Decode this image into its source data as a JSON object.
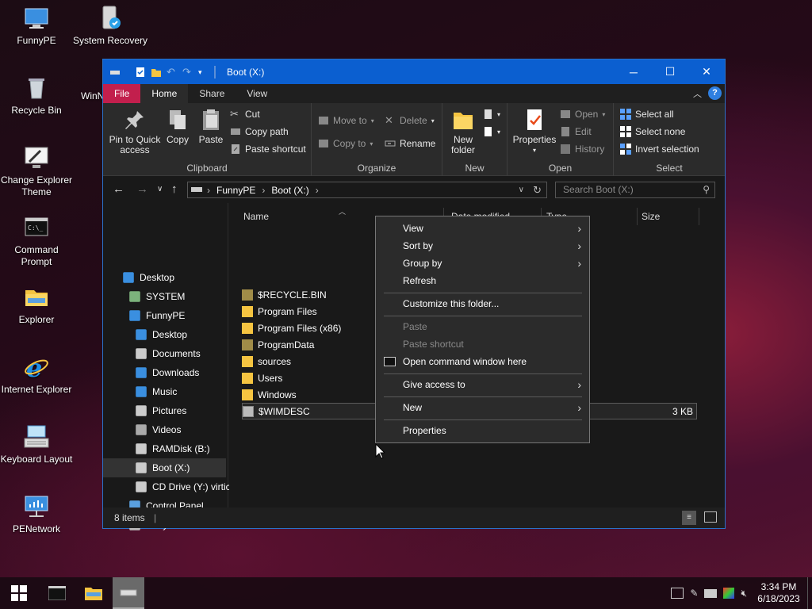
{
  "desktop": {
    "icons": [
      {
        "label": "FunnyPE"
      },
      {
        "label": "System Recovery"
      },
      {
        "label": "Recycle Bin"
      },
      {
        "label": "WinN"
      },
      {
        "label": "Change Explorer Theme"
      },
      {
        "label": "Command Prompt"
      },
      {
        "label": "Explorer"
      },
      {
        "label": "Internet Explorer"
      },
      {
        "label": "Keyboard Layout"
      },
      {
        "label": "PENetwork"
      }
    ]
  },
  "window": {
    "title": "Boot (X:)",
    "tabs": [
      "File",
      "Home",
      "Share",
      "View"
    ],
    "ribbon": {
      "clipboard": {
        "label": "Clipboard",
        "pin": "Pin to Quick access",
        "pin_l1": "Pin to Quick",
        "pin_l2": "access",
        "copy": "Copy",
        "paste": "Paste",
        "cut": "Cut",
        "copy_path": "Copy path",
        "paste_shortcut": "Paste shortcut"
      },
      "organize": {
        "label": "Organize",
        "move_to": "Move to",
        "copy_to": "Copy to",
        "delete": "Delete",
        "rename": "Rename"
      },
      "new": {
        "label": "New",
        "new_folder_l1": "New",
        "new_folder_l2": "folder"
      },
      "open": {
        "label": "Open",
        "properties": "Properties",
        "open": "Open",
        "edit": "Edit",
        "history": "History"
      },
      "select": {
        "label": "Select",
        "select_all": "Select all",
        "select_none": "Select none",
        "invert": "Invert selection"
      }
    },
    "address": {
      "path": [
        "FunnyPE",
        "Boot (X:)"
      ],
      "search_placeholder": "Search Boot (X:)"
    },
    "navpane": [
      {
        "label": "Desktop",
        "icon": "desktop-icon"
      },
      {
        "label": "SYSTEM",
        "icon": "user-icon"
      },
      {
        "label": "FunnyPE",
        "icon": "computer-icon"
      },
      {
        "label": "Desktop",
        "icon": "desktop-icon"
      },
      {
        "label": "Documents",
        "icon": "documents-icon"
      },
      {
        "label": "Downloads",
        "icon": "downloads-icon"
      },
      {
        "label": "Music",
        "icon": "music-icon"
      },
      {
        "label": "Pictures",
        "icon": "pictures-icon"
      },
      {
        "label": "Videos",
        "icon": "videos-icon"
      },
      {
        "label": "RAMDisk (B:)",
        "icon": "drive-icon"
      },
      {
        "label": "Boot (X:)",
        "icon": "drive-icon"
      },
      {
        "label": "CD Drive (Y:) virtic",
        "icon": "cd-drive-icon"
      },
      {
        "label": "Control Panel",
        "icon": "control-panel-icon"
      },
      {
        "label": "Recycle Bin",
        "icon": "recycle-bin-icon"
      }
    ],
    "columns": {
      "name": "Name",
      "date": "Date modified",
      "type": "Type",
      "size": "Size"
    },
    "files": [
      {
        "name": "$RECYCLE.BIN",
        "size": ""
      },
      {
        "name": "Program Files",
        "size": ""
      },
      {
        "name": "Program Files (x86)",
        "size": ""
      },
      {
        "name": "ProgramData",
        "size": ""
      },
      {
        "name": "sources",
        "size": ""
      },
      {
        "name": "Users",
        "size": ""
      },
      {
        "name": "Windows",
        "size": ""
      },
      {
        "name": "$WIMDESC",
        "size": "3 KB"
      }
    ],
    "status": "8 items"
  },
  "context_menu": {
    "items": [
      "View",
      "Sort by",
      "Group by",
      "Refresh",
      "Customize this folder...",
      "Paste",
      "Paste shortcut",
      "Open command window here",
      "Give access to",
      "New",
      "Properties"
    ]
  },
  "taskbar": {
    "time": "3:34 PM",
    "date": "6/18/2023"
  },
  "colors": {
    "titlebar": "#0b5fd0",
    "file_tab": "#c21f4d",
    "folder": "#f5c441"
  }
}
